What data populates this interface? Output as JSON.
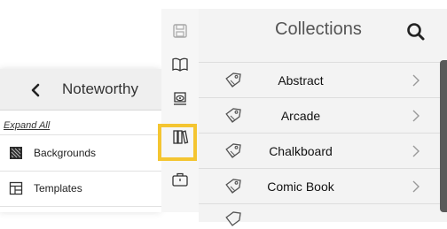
{
  "left_panel": {
    "title": "Noteworthy",
    "expand_all": "Expand All",
    "items": [
      {
        "label": "Backgrounds",
        "icon": "backgrounds-icon"
      },
      {
        "label": "Templates",
        "icon": "templates-icon"
      }
    ]
  },
  "toolbar": {
    "tools": [
      "save-icon",
      "book-icon",
      "stamp-icon",
      "collections-icon",
      "briefcase-icon"
    ],
    "active_tool": "collections-icon",
    "highlight_color": "#f4c531"
  },
  "collections": {
    "title": "Collections",
    "items": [
      {
        "name": "Abstract"
      },
      {
        "name": "Arcade"
      },
      {
        "name": "Chalkboard"
      },
      {
        "name": "Comic Book"
      }
    ]
  }
}
